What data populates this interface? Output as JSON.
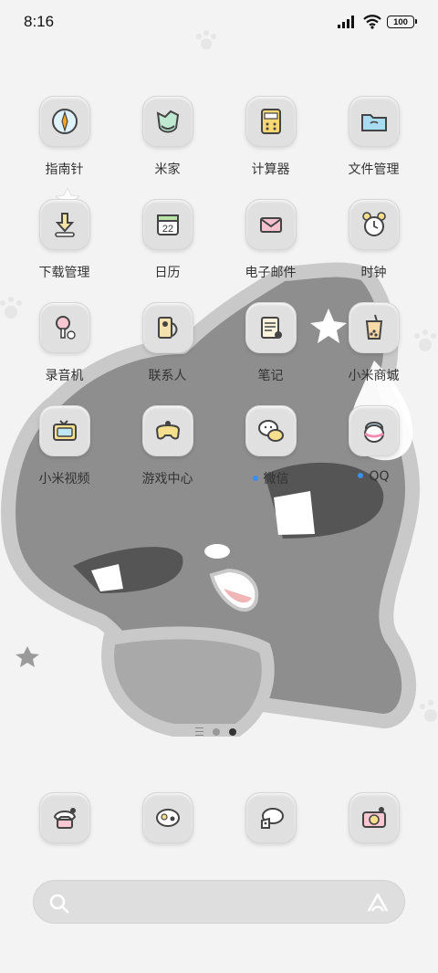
{
  "status_bar": {
    "time": "8:16",
    "battery": "100"
  },
  "apps": [
    {
      "label": "指南针",
      "icon": "compass-icon",
      "name": "app-compass",
      "badge": false
    },
    {
      "label": "米家",
      "icon": "mijia-icon",
      "name": "app-mijia",
      "badge": false
    },
    {
      "label": "计算器",
      "icon": "calculator-icon",
      "name": "app-calculator",
      "badge": false
    },
    {
      "label": "文件管理",
      "icon": "folder-icon",
      "name": "app-file-manager",
      "badge": false
    },
    {
      "label": "下载管理",
      "icon": "download-icon",
      "name": "app-download-manager",
      "badge": false
    },
    {
      "label": "日历",
      "icon": "calendar-icon",
      "name": "app-calendar",
      "badge": false,
      "icon_text": "22"
    },
    {
      "label": "电子邮件",
      "icon": "mail-icon",
      "name": "app-email",
      "badge": false
    },
    {
      "label": "时钟",
      "icon": "alarm-clock-icon",
      "name": "app-clock",
      "badge": false
    },
    {
      "label": "录音机",
      "icon": "recorder-icon",
      "name": "app-recorder",
      "badge": false
    },
    {
      "label": "联系人",
      "icon": "contacts-icon",
      "name": "app-contacts",
      "badge": false
    },
    {
      "label": "笔记",
      "icon": "notes-icon",
      "name": "app-notes",
      "badge": false
    },
    {
      "label": "小米商城",
      "icon": "bubble-tea-icon",
      "name": "app-mi-store",
      "badge": false
    },
    {
      "label": "小米视频",
      "icon": "tv-icon",
      "name": "app-mi-video",
      "badge": false
    },
    {
      "label": "游戏中心",
      "icon": "gamepad-icon",
      "name": "app-game-center",
      "badge": false
    },
    {
      "label": "微信",
      "icon": "wechat-icon",
      "name": "app-wechat",
      "badge": true
    },
    {
      "label": "QQ",
      "icon": "qq-penguin-icon",
      "name": "app-qq",
      "badge": true
    }
  ],
  "dock": [
    {
      "icon": "phone-icon",
      "name": "dock-phone"
    },
    {
      "icon": "messages-icon",
      "name": "dock-messages"
    },
    {
      "icon": "browser-icon",
      "name": "dock-browser"
    },
    {
      "icon": "camera-icon",
      "name": "dock-camera"
    }
  ],
  "pager": {
    "pages": 2,
    "active": 2
  },
  "colors": {
    "badge": "#3b8ff0",
    "cat": "#8e8e8e",
    "cat_outline": "#c8c8c8",
    "background": "#f3f3f3"
  }
}
